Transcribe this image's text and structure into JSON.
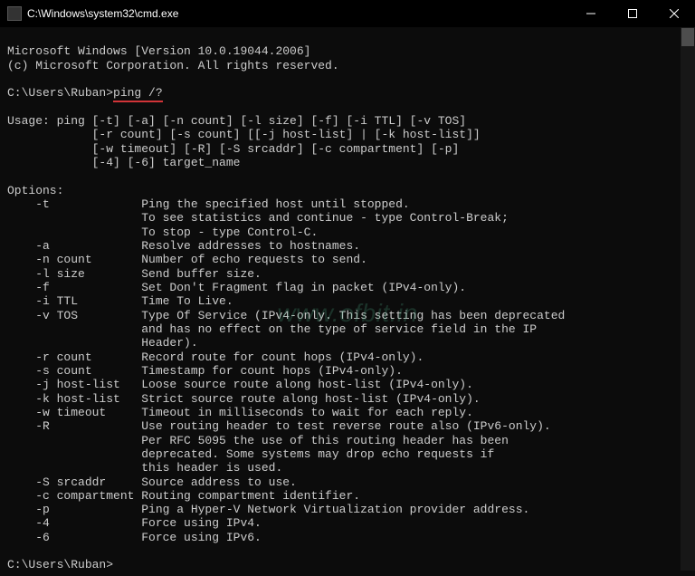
{
  "window": {
    "title": "C:\\Windows\\system32\\cmd.exe"
  },
  "header": {
    "line1": "Microsoft Windows [Version 10.0.19044.2006]",
    "line2": "(c) Microsoft Corporation. All rights reserved."
  },
  "prompt1_prefix": "C:\\Users\\Ruban>",
  "prompt1_cmd": "ping /?",
  "usage": {
    "l1": "Usage: ping [-t] [-a] [-n count] [-l size] [-f] [-i TTL] [-v TOS]",
    "l2": "            [-r count] [-s count] [[-j host-list] | [-k host-list]]",
    "l3": "            [-w timeout] [-R] [-S srcaddr] [-c compartment] [-p]",
    "l4": "            [-4] [-6] target_name"
  },
  "options_label": "Options:",
  "options": [
    {
      "flag": "-t",
      "desc1": "Ping the specified host until stopped.",
      "desc2": "To see statistics and continue - type Control-Break;",
      "desc3": "To stop - type Control-C."
    },
    {
      "flag": "-a",
      "desc1": "Resolve addresses to hostnames."
    },
    {
      "flag": "-n count",
      "desc1": "Number of echo requests to send."
    },
    {
      "flag": "-l size",
      "desc1": "Send buffer size."
    },
    {
      "flag": "-f",
      "desc1": "Set Don't Fragment flag in packet (IPv4-only)."
    },
    {
      "flag": "-i TTL",
      "desc1": "Time To Live."
    },
    {
      "flag": "-v TOS",
      "desc1": "Type Of Service (IPv4-only. This setting has been deprecated",
      "desc2": "and has no effect on the type of service field in the IP",
      "desc3": "Header)."
    },
    {
      "flag": "-r count",
      "desc1": "Record route for count hops (IPv4-only)."
    },
    {
      "flag": "-s count",
      "desc1": "Timestamp for count hops (IPv4-only)."
    },
    {
      "flag": "-j host-list",
      "desc1": "Loose source route along host-list (IPv4-only)."
    },
    {
      "flag": "-k host-list",
      "desc1": "Strict source route along host-list (IPv4-only)."
    },
    {
      "flag": "-w timeout",
      "desc1": "Timeout in milliseconds to wait for each reply."
    },
    {
      "flag": "-R",
      "desc1": "Use routing header to test reverse route also (IPv6-only).",
      "desc2": "Per RFC 5095 the use of this routing header has been",
      "desc3": "deprecated. Some systems may drop echo requests if",
      "desc4": "this header is used."
    },
    {
      "flag": "-S srcaddr",
      "desc1": "Source address to use."
    },
    {
      "flag": "-c compartment",
      "desc1": "Routing compartment identifier."
    },
    {
      "flag": "-p",
      "desc1": "Ping a Hyper-V Network Virtualization provider address."
    },
    {
      "flag": "-4",
      "desc1": "Force using IPv4."
    },
    {
      "flag": "-6",
      "desc1": "Force using IPv6."
    }
  ],
  "prompt2": "C:\\Users\\Ruban>",
  "watermark": "www.ofbit.in"
}
